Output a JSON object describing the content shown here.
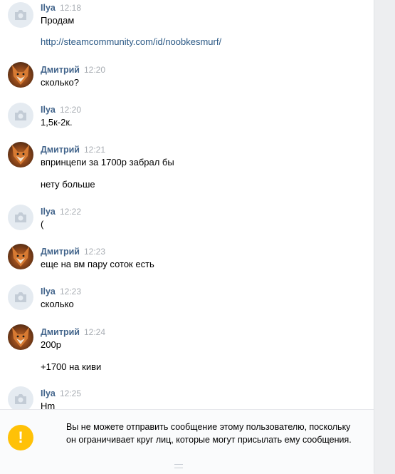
{
  "messages": [
    {
      "author": "Ilya",
      "time": "12:18",
      "avatar": "camera-icon",
      "lines": [
        "Продам",
        "http://steamcommunity.com/id/noobkesmurf/"
      ]
    },
    {
      "author": "Дмитрий",
      "time": "12:20",
      "avatar": "fox-avatar",
      "lines": [
        "сколько?"
      ]
    },
    {
      "author": "Ilya",
      "time": "12:20",
      "avatar": "camera-icon",
      "lines": [
        "1,5к-2к."
      ]
    },
    {
      "author": "Дмитрий",
      "time": "12:21",
      "avatar": "fox-avatar",
      "lines": [
        "впринцепи за 1700р забрал бы",
        "нету больше"
      ]
    },
    {
      "author": "Ilya",
      "time": "12:22",
      "avatar": "camera-icon",
      "lines": [
        "("
      ]
    },
    {
      "author": "Дмитрий",
      "time": "12:23",
      "avatar": "fox-avatar",
      "lines": [
        "еще на вм пару соток есть"
      ]
    },
    {
      "author": "Ilya",
      "time": "12:23",
      "avatar": "camera-icon",
      "lines": [
        "сколько"
      ]
    },
    {
      "author": "Дмитрий",
      "time": "12:24",
      "avatar": "fox-avatar",
      "lines": [
        "200р",
        "+1700 на киви"
      ]
    },
    {
      "author": "Ilya",
      "time": "12:25",
      "avatar": "camera-icon",
      "lines": [
        "Hm"
      ]
    }
  ],
  "footer": {
    "warning_icon": "exclamation-icon",
    "warning_symbol": "!",
    "warning_text": "Вы не можете отправить сообщение этому пользователю, поскольку он ограничивает круг лиц, которые могут присылать ему сообщения."
  },
  "colors": {
    "author": "#42648b",
    "link": "#2a5885",
    "time": "#a8adb3",
    "warning": "#ffc107"
  }
}
